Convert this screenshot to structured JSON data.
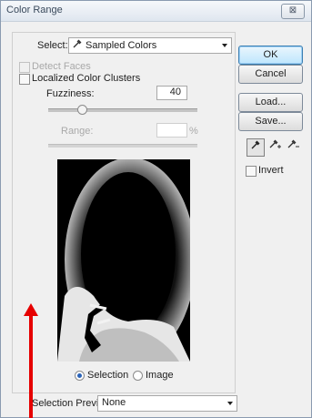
{
  "window": {
    "title": "Color Range",
    "close_label": "⊠"
  },
  "select": {
    "label": "Select:",
    "value": "Sampled Colors"
  },
  "options": {
    "detect_faces": {
      "label": "Detect Faces",
      "checked": false,
      "enabled": false
    },
    "localized_clusters": {
      "label": "Localized Color Clusters",
      "checked": false,
      "enabled": true
    }
  },
  "fuzziness": {
    "label": "Fuzziness:",
    "value": "40"
  },
  "range": {
    "label": "Range:",
    "value": "",
    "unit": "%"
  },
  "preview_mode": {
    "selection_label": "Selection",
    "image_label": "Image",
    "selected": "Selection"
  },
  "selection_preview": {
    "label": "Selection Preview:",
    "value": "None"
  },
  "buttons": {
    "ok": "OK",
    "cancel": "Cancel",
    "load": "Load...",
    "save": "Save..."
  },
  "tools": [
    "eyedropper",
    "eyedropper-plus",
    "eyedropper-minus"
  ],
  "invert": {
    "label": "Invert",
    "checked": false
  },
  "colors": {
    "annotation_arrow": "#e60000",
    "default_button": "#3c7fb1"
  }
}
